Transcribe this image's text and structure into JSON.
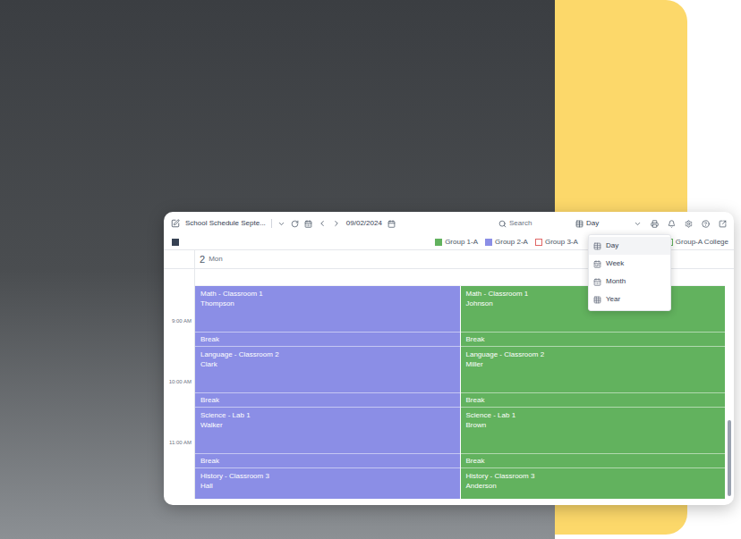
{
  "toolbar": {
    "document_title": "School Schedule Septe...",
    "date": "09/02/2024",
    "search_placeholder": "Search",
    "view": "Day"
  },
  "legend": [
    {
      "label": "Group 1-A",
      "checked": true,
      "color": "#62b25e"
    },
    {
      "label": "Group 2-A",
      "checked": true,
      "color": "#8b8ee6"
    },
    {
      "label": "Group 3-A",
      "checked": false,
      "color": "#e06666"
    },
    {
      "label": "Group-A College",
      "checked": false,
      "color": "#62b25e"
    }
  ],
  "view_menu": [
    {
      "label": "Day",
      "selected": true
    },
    {
      "label": "Week",
      "selected": false
    },
    {
      "label": "Month",
      "selected": false
    },
    {
      "label": "Year",
      "selected": false
    }
  ],
  "day_header": {
    "day": "2",
    "weekday": "Mon"
  },
  "time_labels": [
    "9:00 AM",
    "10:00 AM",
    "11:00 AM"
  ],
  "columns": [
    {
      "color": "#8b8ee6",
      "events": [
        {
          "kind": "lesson",
          "title": "Math - Classroom 1",
          "teacher": "Thompson"
        },
        {
          "kind": "break",
          "title": "Break"
        },
        {
          "kind": "lesson",
          "title": "Language - Classroom 2",
          "teacher": "Clark"
        },
        {
          "kind": "break",
          "title": "Break"
        },
        {
          "kind": "lesson",
          "title": "Science - Lab 1",
          "teacher": "Walker"
        },
        {
          "kind": "break",
          "title": "Break"
        },
        {
          "kind": "lesson",
          "title": "History - Classroom 3",
          "teacher": "Hall"
        }
      ]
    },
    {
      "color": "#62b25e",
      "events": [
        {
          "kind": "lesson",
          "title": "Math - Classroom 1",
          "teacher": "Johnson"
        },
        {
          "kind": "break",
          "title": "Break"
        },
        {
          "kind": "lesson",
          "title": "Language - Classroom 2",
          "teacher": "Miller"
        },
        {
          "kind": "break",
          "title": "Break"
        },
        {
          "kind": "lesson",
          "title": "Science - Lab 1",
          "teacher": "Brown"
        },
        {
          "kind": "break",
          "title": "Break"
        },
        {
          "kind": "lesson",
          "title": "History - Classroom 3",
          "teacher": "Anderson"
        }
      ]
    }
  ]
}
